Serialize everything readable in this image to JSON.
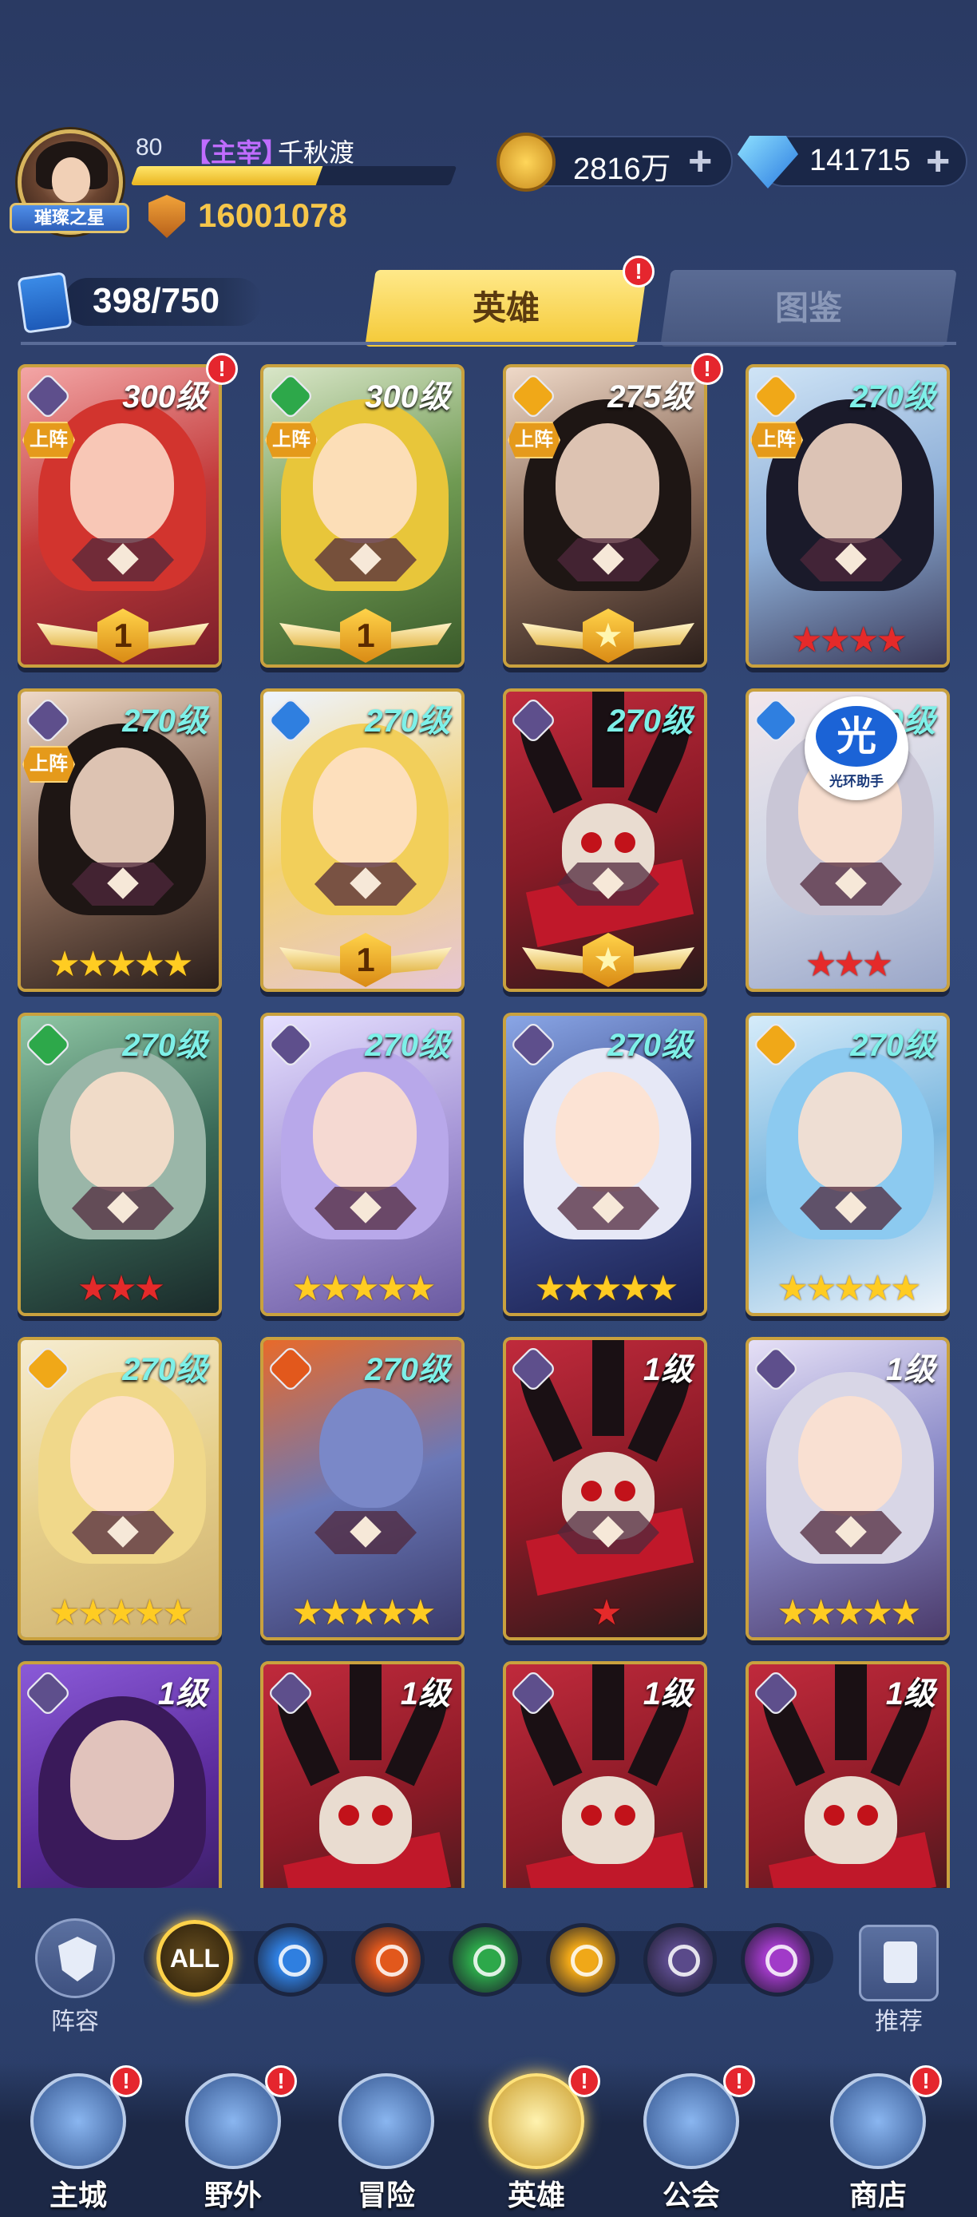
{
  "player": {
    "badge": "璀璨之星",
    "level": "80",
    "rank": "【主宰】",
    "name": "千秋渡",
    "exp_progress": 0.58,
    "power": "16001078"
  },
  "resources": {
    "gold": "2816万",
    "gems": "141715"
  },
  "hero_count": "398/750",
  "tabs": {
    "heroes": "英雄",
    "codex": "图鉴",
    "alert": "!"
  },
  "on_team_label": "上阵",
  "helper": {
    "badge": "光",
    "label": "光环助手"
  },
  "heroes": [
    {
      "level": "300级",
      "faction": "dark",
      "on_team": true,
      "alert": true,
      "grade": "wing",
      "grade_value": "1",
      "theme": "red-hair"
    },
    {
      "level": "300级",
      "faction": "nature",
      "on_team": true,
      "alert": false,
      "grade": "wing",
      "grade_value": "1",
      "theme": "blonde-hood"
    },
    {
      "level": "275级",
      "faction": "light",
      "on_team": true,
      "alert": true,
      "grade": "wing-star",
      "grade_value": "★",
      "theme": "black-hair"
    },
    {
      "level": "270级",
      "faction": "light",
      "on_team": true,
      "alert": false,
      "grade": "red-stars",
      "stars": "★★★★",
      "theme": "dark-hair-blue"
    },
    {
      "level": "270级",
      "faction": "dark",
      "on_team": true,
      "alert": false,
      "grade": "gold-stars",
      "stars": "★★★★★",
      "theme": "black-hair"
    },
    {
      "level": "270级",
      "faction": "water",
      "on_team": false,
      "alert": false,
      "grade": "wing",
      "grade_value": "1",
      "theme": "blonde-bride"
    },
    {
      "level": "270级",
      "faction": "dark",
      "on_team": false,
      "alert": false,
      "grade": "wing-star",
      "grade_value": "★",
      "theme": "skull"
    },
    {
      "level": "270级",
      "faction": "water",
      "on_team": false,
      "alert": false,
      "grade": "red-stars",
      "stars": "★★★",
      "theme": "silver-pet",
      "helper": true
    },
    {
      "level": "270级",
      "faction": "nature",
      "on_team": false,
      "alert": false,
      "grade": "red-stars",
      "stars": "★★★",
      "theme": "elf"
    },
    {
      "level": "270级",
      "faction": "dark",
      "on_team": false,
      "alert": false,
      "grade": "gold-stars",
      "stars": "★★★★★",
      "theme": "lilac"
    },
    {
      "level": "270级",
      "faction": "dark",
      "on_team": false,
      "alert": false,
      "grade": "gold-stars",
      "stars": "★★★★★",
      "theme": "white-demon"
    },
    {
      "level": "270级",
      "faction": "light",
      "on_team": false,
      "alert": false,
      "grade": "gold-stars",
      "stars": "★★★★★",
      "theme": "ice-blue"
    },
    {
      "level": "270级",
      "faction": "light",
      "on_team": false,
      "alert": false,
      "grade": "gold-stars",
      "stars": "★★★★★",
      "theme": "blonde-long"
    },
    {
      "level": "270级",
      "faction": "fire",
      "on_team": false,
      "alert": false,
      "grade": "gold-stars",
      "stars": "★★★★★",
      "theme": "orc"
    },
    {
      "level": "1级",
      "faction": "dark",
      "on_team": false,
      "alert": false,
      "grade": "red-stars",
      "stars": "★",
      "theme": "skull"
    },
    {
      "level": "1级",
      "faction": "dark",
      "on_team": false,
      "alert": false,
      "grade": "gold-stars",
      "stars": "★★★★★",
      "theme": "silver-glasses"
    },
    {
      "level": "1级",
      "faction": "dark",
      "on_team": false,
      "alert": false,
      "grade": "none",
      "theme": "purple-demon"
    },
    {
      "level": "1级",
      "faction": "dark",
      "on_team": false,
      "alert": false,
      "grade": "none",
      "theme": "skull"
    },
    {
      "level": "1级",
      "faction": "dark",
      "on_team": false,
      "alert": false,
      "grade": "none",
      "theme": "skull"
    },
    {
      "level": "1级",
      "faction": "dark",
      "on_team": false,
      "alert": false,
      "grade": "none",
      "theme": "skull"
    }
  ],
  "filter": {
    "lineup_label": "阵容",
    "recommend_label": "推荐",
    "all_label": "ALL",
    "factions": [
      {
        "icon": "water-faction-icon",
        "color": "#2f7fe0"
      },
      {
        "icon": "fire-faction-icon",
        "color": "#e2581c"
      },
      {
        "icon": "nature-faction-icon",
        "color": "#2da84a"
      },
      {
        "icon": "light-faction-icon",
        "color": "#f0a818"
      },
      {
        "icon": "dark-faction-icon",
        "color": "#5a4a8a"
      },
      {
        "icon": "arcane-faction-icon",
        "color": "#a13ac8"
      }
    ]
  },
  "nav": [
    {
      "label": "主城",
      "icon": "castle-icon",
      "alert": true
    },
    {
      "label": "野外",
      "icon": "portal-icon",
      "alert": true
    },
    {
      "label": "冒险",
      "icon": "trident-icon",
      "alert": false
    },
    {
      "label": "英雄",
      "icon": "helmet-icon",
      "alert": true,
      "active": true
    },
    {
      "label": "公会",
      "icon": "guild-banner-icon",
      "alert": true
    },
    {
      "label": "商店",
      "icon": "shop-icon",
      "alert": true
    }
  ]
}
